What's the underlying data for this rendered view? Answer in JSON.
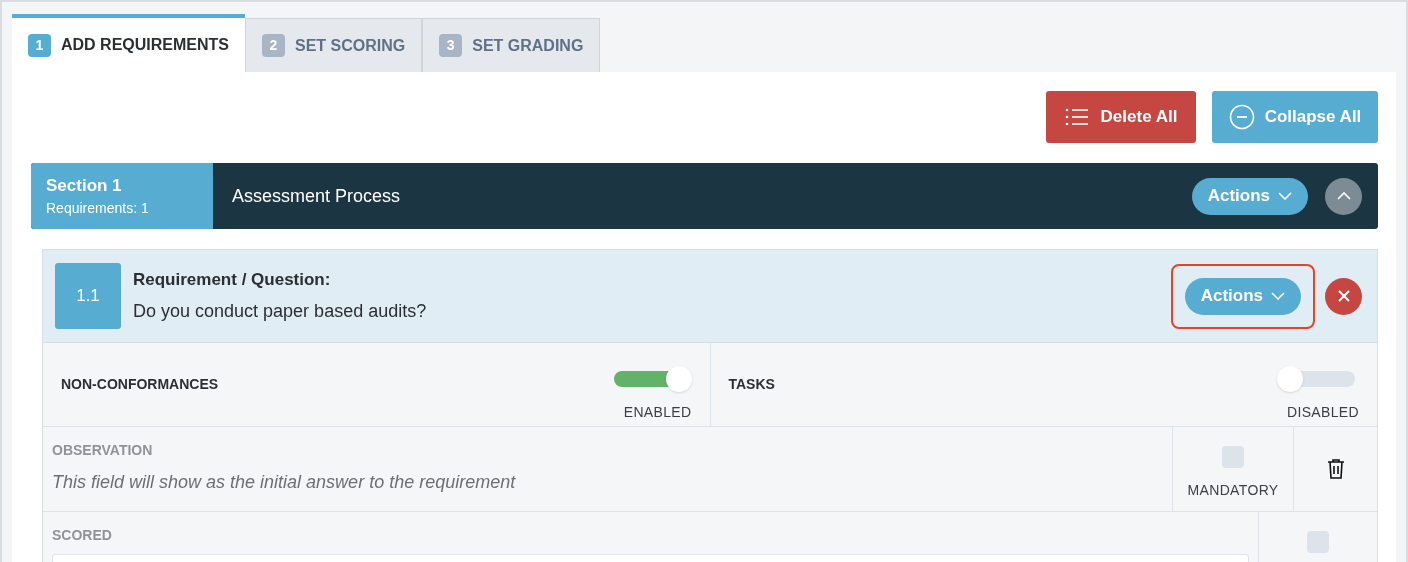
{
  "tabs": [
    {
      "number": "1",
      "label": "ADD REQUIREMENTS",
      "selected": true
    },
    {
      "number": "2",
      "label": "SET SCORING",
      "selected": false
    },
    {
      "number": "3",
      "label": "SET GRADING",
      "selected": false
    }
  ],
  "toolbar": {
    "delete_all": "Delete All",
    "collapse_all": "Collapse All"
  },
  "section": {
    "title": "Section 1",
    "count": "Requirements: 1",
    "name": "Assessment Process",
    "actions": "Actions",
    "expanded": true
  },
  "requirement": {
    "number": "1.1",
    "heading": "Requirement / Question:",
    "text": "Do you conduct paper based audits?",
    "actions": "Actions",
    "actions_highlighted": true,
    "switches": [
      {
        "label": "NON-CONFORMANCES",
        "on": true,
        "state": "ENABLED"
      },
      {
        "label": "TASKS",
        "on": false,
        "state": "DISABLED"
      }
    ],
    "observation": {
      "label": "OBSERVATION",
      "placeholder": "This field will show as the initial answer to the requirement",
      "mandatory_label": "MANDATORY",
      "mandatory": false
    },
    "scored": {
      "label": "SCORED",
      "checked": false
    }
  }
}
